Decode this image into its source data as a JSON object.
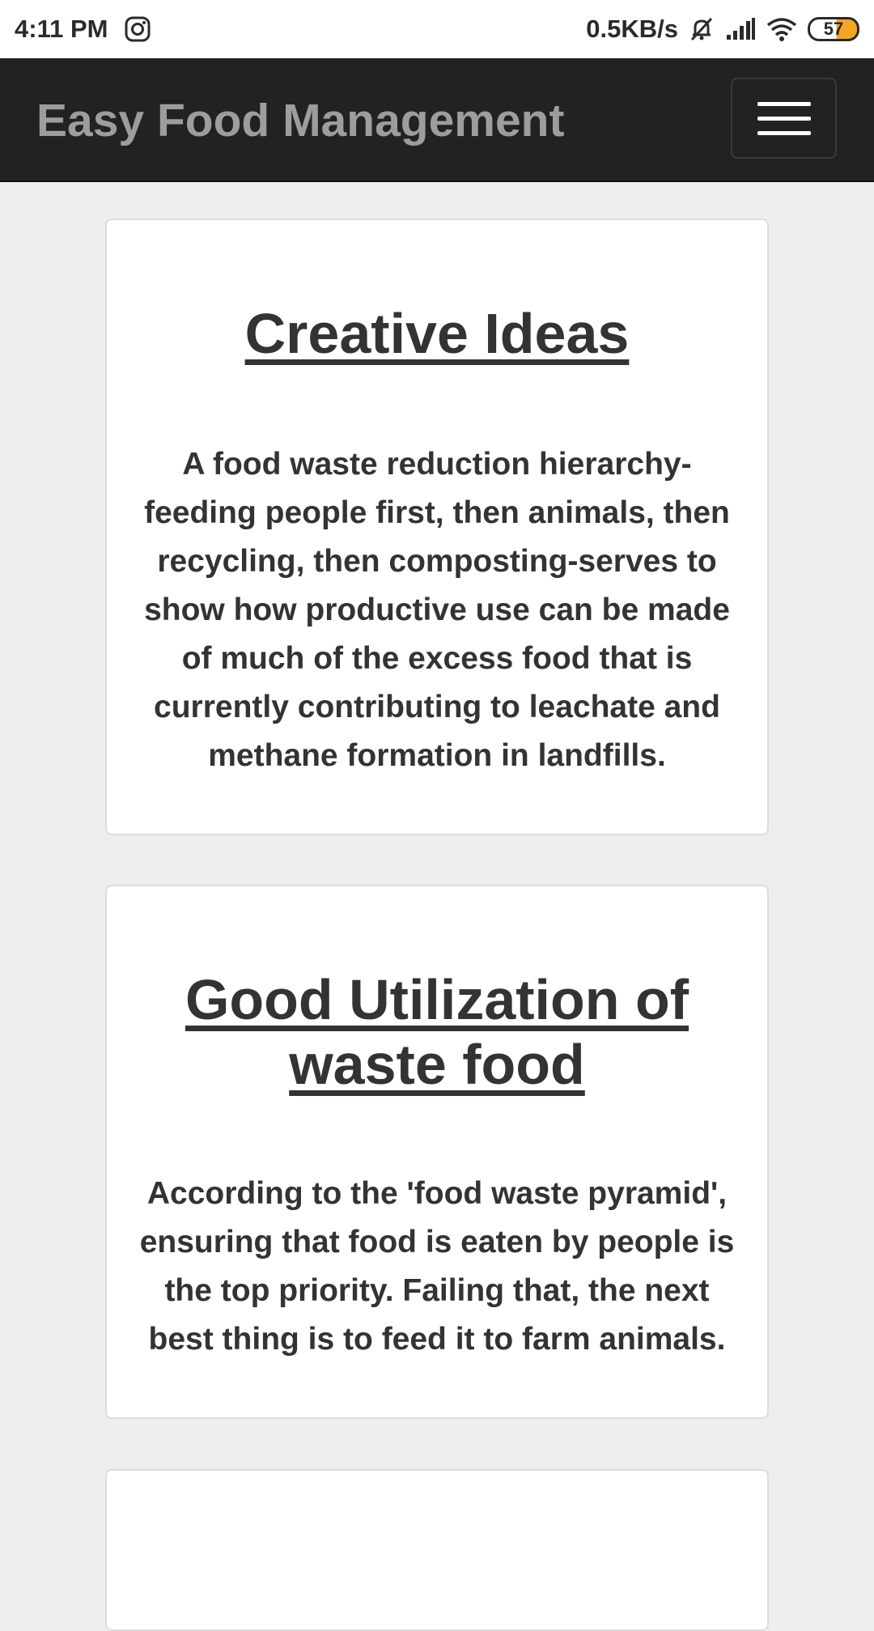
{
  "status_bar": {
    "time": "4:11 PM",
    "network_speed": "0.5KB/s",
    "battery": "57",
    "icons": [
      "instagram-icon",
      "muted-bell-icon",
      "signal-icon",
      "wifi-icon",
      "battery-icon"
    ]
  },
  "navbar": {
    "brand": "Easy Food Management",
    "menu_icon": "hamburger-menu-icon"
  },
  "cards": [
    {
      "title": "Creative Ideas",
      "body": "A food waste reduction hierarchy- feeding people first, then animals, then recycling, then composting-serves to show how productive use can be made of much of the excess food that is currently contributing to leachate and methane formation in landfills."
    },
    {
      "title": "Good Utilization of waste food",
      "body": "According to the 'food waste pyramid', ensuring that food is eaten by people is the top priority. Failing that, the next best thing is to feed it to farm animals."
    }
  ],
  "colors": {
    "navbar_bg": "#222222",
    "brand_text": "#9d9d9d",
    "page_bg": "#eeeeee",
    "card_text": "#333333",
    "battery_fill": "#f6a623"
  }
}
